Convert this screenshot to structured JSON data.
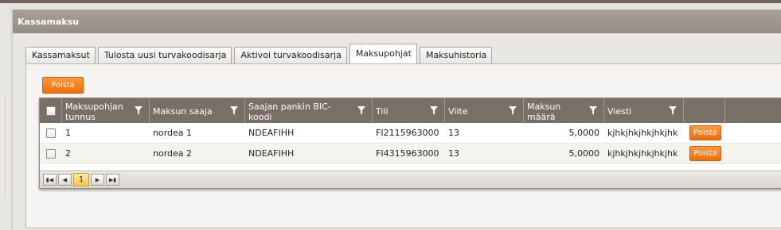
{
  "panel": {
    "title": "Kassamaksu"
  },
  "tabs": [
    {
      "label": "Kassamaksut"
    },
    {
      "label": "Tulosta uusi turvakoodisarja"
    },
    {
      "label": "Aktivoi turvakoodisarja"
    },
    {
      "label": "Maksupohjat",
      "active": true
    },
    {
      "label": "Maksuhistoria"
    }
  ],
  "toolbar": {
    "delete_label": "Poista"
  },
  "grid": {
    "columns": [
      {
        "label": "Maksupohjan tunnus"
      },
      {
        "label": "Maksun saaja"
      },
      {
        "label": "Saajan pankin BIC-koodi"
      },
      {
        "label": "Tili"
      },
      {
        "label": "Viite"
      },
      {
        "label": "Maksun määrä"
      },
      {
        "label": "Viesti"
      }
    ],
    "rows": [
      {
        "id": "1",
        "payee": "nordea 1",
        "bic": "NDEAFIHH",
        "account": "FI2115963000",
        "reference": "13",
        "amount": "5,0000",
        "message": "kjhkjhkjhkjhkjhk",
        "delete_label": "Poista"
      },
      {
        "id": "2",
        "payee": "nordea 2",
        "bic": "NDEAFIHH",
        "account": "FI4315963000",
        "reference": "13",
        "amount": "5,0000",
        "message": "kjhkjhkjhkjhkjhk",
        "delete_label": "Poista"
      }
    ]
  },
  "pager": {
    "current_page": "1"
  },
  "icons": {
    "filter": "filter-icon",
    "first": "first-page-icon",
    "prev": "prev-page-icon",
    "next": "next-page-icon",
    "last": "last-page-icon"
  },
  "colors": {
    "accent": "#f47a1f",
    "header": "#7a6f66",
    "panel_header": "#9e958b"
  }
}
